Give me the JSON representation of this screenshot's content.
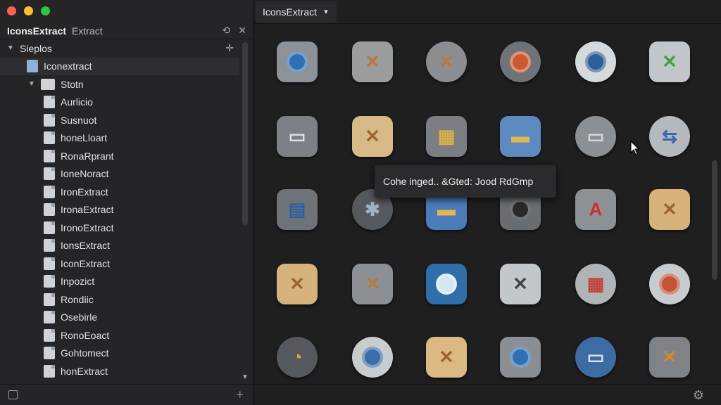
{
  "sidebar": {
    "app_name": "IconsExtract",
    "subtitle": "Extract",
    "header_btn_refresh": "⟲",
    "header_btn_close": "✕",
    "tree": [
      {
        "label": "Sieplos",
        "level": 0,
        "type": "group",
        "expanded": true
      },
      {
        "label": "Iconextract",
        "level": 1,
        "type": "app",
        "selected": true
      },
      {
        "label": "Stotn",
        "level": 1,
        "type": "folder",
        "expanded": true
      },
      {
        "label": "Aurlicio",
        "level": 2,
        "type": "doc"
      },
      {
        "label": "Susnuot",
        "level": 2,
        "type": "doc"
      },
      {
        "label": "honeLloart",
        "level": 2,
        "type": "doc"
      },
      {
        "label": "RonaRprant",
        "level": 2,
        "type": "doc"
      },
      {
        "label": "IoneNoract",
        "level": 2,
        "type": "doc"
      },
      {
        "label": "IronExtract",
        "level": 2,
        "type": "doc"
      },
      {
        "label": "IronaExtract",
        "level": 2,
        "type": "doc"
      },
      {
        "label": "IronoExtract",
        "level": 2,
        "type": "doc"
      },
      {
        "label": "IonsExtract",
        "level": 2,
        "type": "doc"
      },
      {
        "label": "IconExtract",
        "level": 2,
        "type": "doc"
      },
      {
        "label": "Inpozict",
        "level": 2,
        "type": "doc"
      },
      {
        "label": "Rondiic",
        "level": 2,
        "type": "doc"
      },
      {
        "label": "Osebirle",
        "level": 2,
        "type": "doc"
      },
      {
        "label": "RonoEoact",
        "level": 2,
        "type": "doc"
      },
      {
        "label": "Gohtomect",
        "level": 2,
        "type": "doc"
      },
      {
        "label": "honExtract",
        "level": 2,
        "type": "doc"
      }
    ]
  },
  "main": {
    "tab_label": "IconsExtract",
    "tooltip": "Cohe inged.. &Gted: Jood RdGmp"
  },
  "icons": [
    {
      "name": "disk-utility-icon",
      "shape": "rounded",
      "bg": "#8d9298",
      "inner": "#2f6fb3",
      "glyph": ""
    },
    {
      "name": "tools-gray-icon",
      "shape": "rounded",
      "bg": "#9a9c9e",
      "inner": "",
      "glyph": "✕",
      "gc": "#b8793c"
    },
    {
      "name": "tools-gear-icon",
      "shape": "gear",
      "bg": "#8b8d90",
      "inner": "",
      "glyph": "✕",
      "gc": "#b8793c"
    },
    {
      "name": "gear-orange-icon",
      "shape": "gear",
      "bg": "#6f7277",
      "inner": "#c95a2e",
      "glyph": ""
    },
    {
      "name": "gear-blue-icon",
      "shape": "gear",
      "bg": "#d7dadd",
      "inner": "#2e5f99",
      "glyph": ""
    },
    {
      "name": "green-tools-icon",
      "shape": "rounded",
      "bg": "#c3c6c9",
      "inner": "",
      "glyph": "✕",
      "gc": "#3ca24a"
    },
    {
      "name": "folder-gray-icon",
      "shape": "rounded",
      "bg": "#7d8186",
      "inner": "",
      "glyph": "▭",
      "gc": "#e0e2e4"
    },
    {
      "name": "magnifier-tools-icon",
      "shape": "rounded",
      "bg": "#d8b988",
      "inner": "",
      "glyph": "✕",
      "gc": "#9a6630"
    },
    {
      "name": "dashboard-file-icon",
      "shape": "rounded",
      "bg": "#7b7f84",
      "inner": "",
      "glyph": "▦",
      "gc": "#d8b04a"
    },
    {
      "name": "blue-folder-icon",
      "shape": "rounded",
      "bg": "#5d8bc0",
      "inner": "",
      "glyph": "▬",
      "gc": "#e2b84c"
    },
    {
      "name": "folder-gear-icon",
      "shape": "gear",
      "bg": "#8c8f93",
      "inner": "",
      "glyph": "▭",
      "gc": "#d7d9db"
    },
    {
      "name": "arrows-gear-icon",
      "shape": "gear",
      "bg": "#b6b9bc",
      "inner": "",
      "glyph": "⇆",
      "gc": "#3b66b0"
    },
    {
      "name": "blue-drive-icon",
      "shape": "rounded",
      "bg": "#6f7378",
      "inner": "",
      "glyph": "▤",
      "gc": "#2d5ea5"
    },
    {
      "name": "compass-gear-icon",
      "shape": "gear",
      "bg": "#55595e",
      "inner": "",
      "glyph": "✱",
      "gc": "#9fb2c4"
    },
    {
      "name": "yellow-folder-icon",
      "shape": "rounded",
      "bg": "#4b7cb8",
      "inner": "",
      "glyph": "▬",
      "gc": "#e2b84c"
    },
    {
      "name": "target-icon",
      "shape": "rounded",
      "bg": "#6a6d70",
      "inner": "#2a2a2a",
      "glyph": ""
    },
    {
      "name": "font-a-icon",
      "shape": "rounded",
      "bg": "#8e9194",
      "inner": "",
      "glyph": "A",
      "gc": "#c8322e"
    },
    {
      "name": "tan-tools-icon",
      "shape": "rounded",
      "bg": "#d7b27a",
      "inner": "",
      "glyph": "✕",
      "gc": "#9a6630"
    },
    {
      "name": "tan-tools-2-icon",
      "shape": "rounded",
      "bg": "#d6b37c",
      "inner": "",
      "glyph": "✕",
      "gc": "#9a6630"
    },
    {
      "name": "wrench-hammer-icon",
      "shape": "rounded",
      "bg": "#8c9094",
      "inner": "",
      "glyph": "✕",
      "gc": "#b8793c"
    },
    {
      "name": "blue-magnifier-icon",
      "shape": "rounded",
      "bg": "#2f6ea8",
      "inner": "#d6e6f4",
      "glyph": ""
    },
    {
      "name": "wrench-white-icon",
      "shape": "rounded",
      "bg": "#c4c7ca",
      "inner": "",
      "glyph": "✕",
      "gc": "#444"
    },
    {
      "name": "dashboard-gear-icon",
      "shape": "gear",
      "bg": "#b1b4b7",
      "inner": "",
      "glyph": "▦",
      "gc": "#c3423a"
    },
    {
      "name": "gear-red-icon",
      "shape": "gear",
      "bg": "#c9ccce",
      "inner": "#c55435",
      "glyph": ""
    },
    {
      "name": "pencil-chart-icon",
      "shape": "gear",
      "bg": "#55595e",
      "inner": "",
      "glyph": "◔",
      "gc": "#d4a84a"
    },
    {
      "name": "utility-gear-icon",
      "shape": "gear",
      "bg": "#c9ccce",
      "inner": "#3b6ea7",
      "glyph": ""
    },
    {
      "name": "tan-tools-3-icon",
      "shape": "rounded",
      "bg": "#dcb982",
      "inner": "",
      "glyph": "✕",
      "gc": "#9a6630"
    },
    {
      "name": "disk-blue-icon",
      "shape": "rounded",
      "bg": "#8b8f94",
      "inner": "#2f6fb3",
      "glyph": ""
    },
    {
      "name": "blue-gear-folder-icon",
      "shape": "gear",
      "bg": "#3d6ca5",
      "inner": "",
      "glyph": "▭",
      "gc": "#e0e2e4"
    },
    {
      "name": "wrench-dark-icon",
      "shape": "rounded",
      "bg": "#7f8287",
      "inner": "",
      "glyph": "✕",
      "gc": "#d3892f"
    }
  ]
}
